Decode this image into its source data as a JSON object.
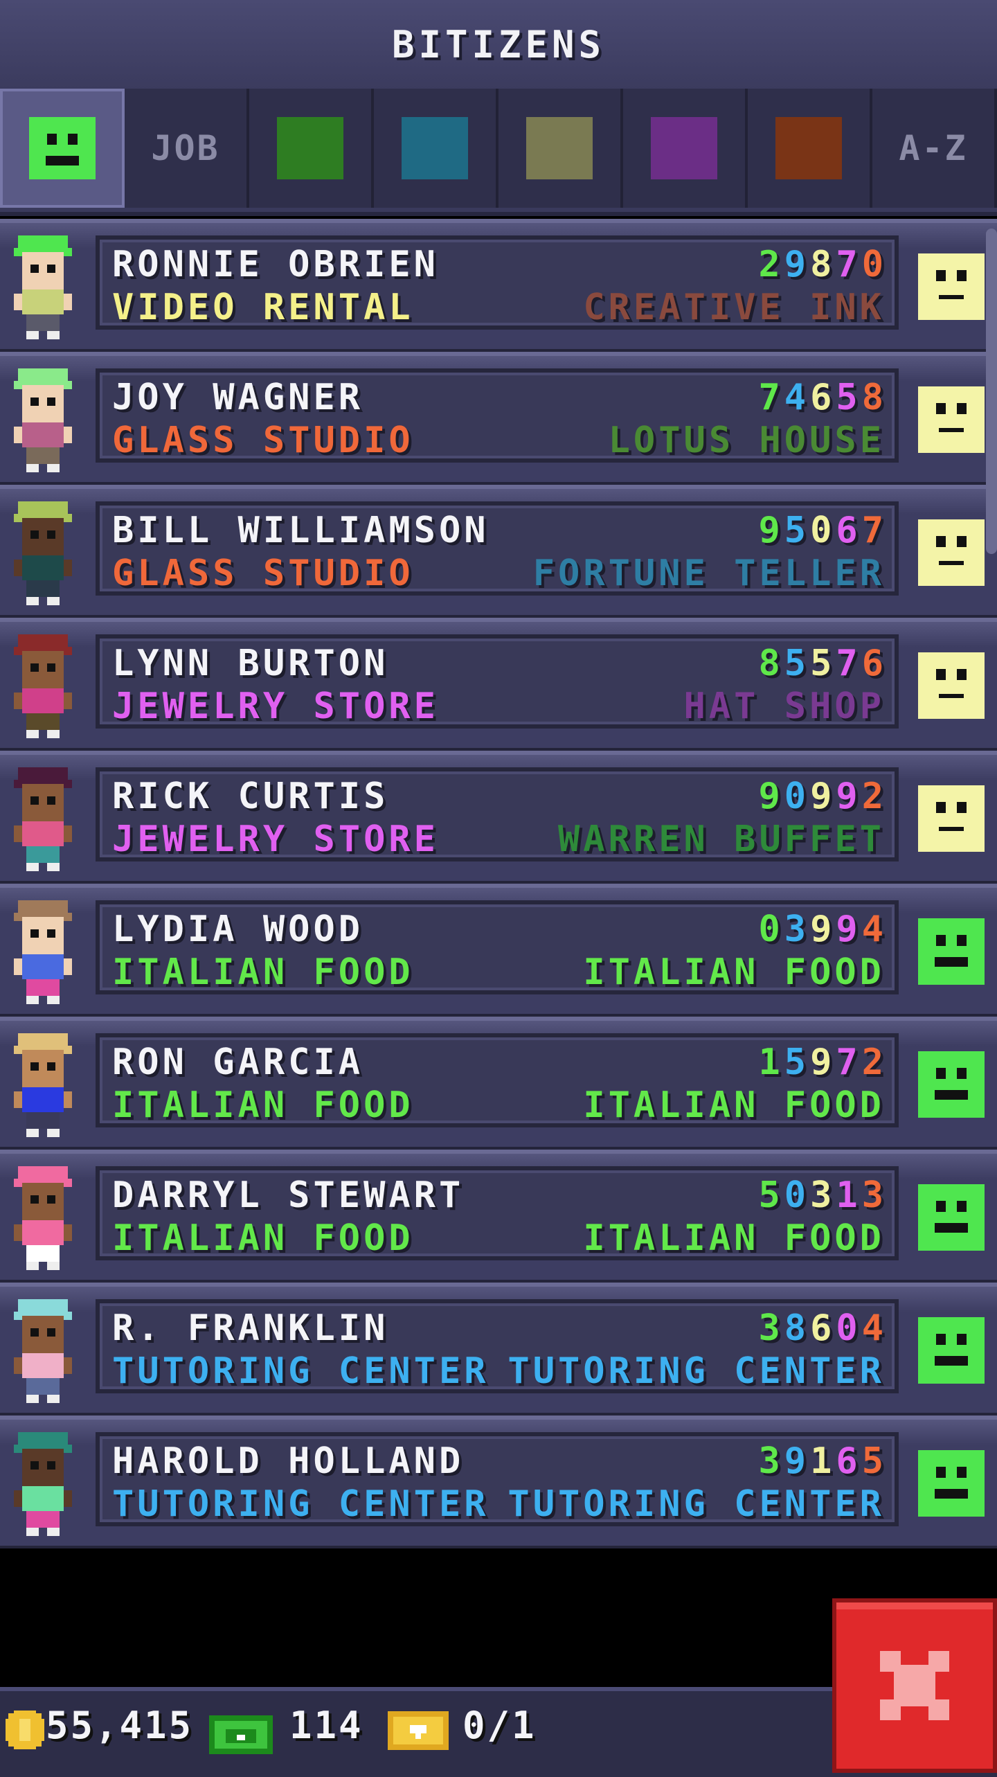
{
  "header": {
    "title": "BITIZENS"
  },
  "tabs": [
    {
      "type": "face",
      "color": "#4fe64f"
    },
    {
      "type": "text",
      "label": "JOB"
    },
    {
      "type": "swatch",
      "color": "#2e7d22"
    },
    {
      "type": "swatch",
      "color": "#1f6a84"
    },
    {
      "type": "swatch",
      "color": "#7a7a52"
    },
    {
      "type": "swatch",
      "color": "#6b2e86"
    },
    {
      "type": "swatch",
      "color": "#7a3416"
    },
    {
      "type": "text",
      "label": "A-Z"
    }
  ],
  "digit_colors": [
    "#5fe84a",
    "#3db0f0",
    "#f0f0a0",
    "#e060f0",
    "#f06a3a"
  ],
  "bitizens": [
    {
      "name": "RONNIE OBRIEN",
      "digits": "29870",
      "job": "VIDEO RENTAL",
      "job_color": "#f4f08a",
      "dream": "CREATIVE INK",
      "dream_color": "#8a4a3e",
      "mood": "neutral",
      "hair": "#4fe64f",
      "skin": "#f0d2b4",
      "shirt": "#c8d27a",
      "pants": "#5a5a6a"
    },
    {
      "name": "JOY WAGNER",
      "digits": "74658",
      "job": "GLASS STUDIO",
      "job_color": "#f0683a",
      "dream": "LOTUS HOUSE",
      "dream_color": "#4a8a34",
      "mood": "neutral",
      "hair": "#8aea8a",
      "skin": "#f0d2b4",
      "shirt": "#b8608a",
      "pants": "#7a6a5a"
    },
    {
      "name": "BILL WILLIAMSON",
      "digits": "95067",
      "job": "GLASS STUDIO",
      "job_color": "#f0683a",
      "dream": "FORTUNE TELLER",
      "dream_color": "#2e7ea4",
      "mood": "neutral",
      "hair": "#a8c45a",
      "skin": "#5a3a28",
      "shirt": "#1e4a4a",
      "pants": "#2a3a4a"
    },
    {
      "name": "LYNN BURTON",
      "digits": "85576",
      "job": "JEWELRY STORE",
      "job_color": "#e060f0",
      "dream": "HAT SHOP",
      "dream_color": "#7a3a92",
      "mood": "neutral",
      "hair": "#8a2a2a",
      "skin": "#8a5a3a",
      "shirt": "#d0408a",
      "pants": "#5a4a2a"
    },
    {
      "name": "RICK CURTIS",
      "digits": "90992",
      "job": "JEWELRY STORE",
      "job_color": "#e060f0",
      "dream": "WARREN BUFFET",
      "dream_color": "#2e8a3a",
      "mood": "neutral",
      "hair": "#4a1a3a",
      "skin": "#8a5a3a",
      "shirt": "#e05a8a",
      "pants": "#3a9a9a"
    },
    {
      "name": "LYDIA WOOD",
      "digits": "03994",
      "job": "ITALIAN FOOD",
      "job_color": "#62e84a",
      "dream": "ITALIAN FOOD",
      "dream_color": "#62e84a",
      "mood": "happy",
      "hair": "#a07a5a",
      "skin": "#f0d2b4",
      "shirt": "#4a6ae0",
      "pants": "#e04aa0"
    },
    {
      "name": "RON GARCIA",
      "digits": "15972",
      "job": "ITALIAN FOOD",
      "job_color": "#62e84a",
      "dream": "ITALIAN FOOD",
      "dream_color": "#62e84a",
      "mood": "happy",
      "hair": "#e0c07a",
      "skin": "#c08a5a",
      "shirt": "#2a3ae0",
      "pants": "#3a3a5a"
    },
    {
      "name": "DARRYL STEWART",
      "digits": "50313",
      "job": "ITALIAN FOOD",
      "job_color": "#62e84a",
      "dream": "ITALIAN FOOD",
      "dream_color": "#62e84a",
      "mood": "happy",
      "hair": "#f06aa0",
      "skin": "#8a5a3a",
      "shirt": "#f06aa0",
      "pants": "#ffffff"
    },
    {
      "name": "R. FRANKLIN",
      "digits": "38604",
      "job": "TUTORING CENTER",
      "job_color": "#3db0f0",
      "dream": "TUTORING CENTER",
      "dream_color": "#3db0f0",
      "mood": "happy",
      "hair": "#8adada",
      "skin": "#8a5a3a",
      "shirt": "#f0b0c8",
      "pants": "#5a6a9a"
    },
    {
      "name": "HAROLD HOLLAND",
      "digits": "39165",
      "job": "TUTORING CENTER",
      "job_color": "#3db0f0",
      "dream": "TUTORING CENTER",
      "dream_color": "#3db0f0",
      "mood": "happy",
      "hair": "#2a8a7a",
      "skin": "#5a3a28",
      "shirt": "#6ae0a0",
      "pants": "#e04aa0"
    }
  ],
  "mood_colors": {
    "neutral": "#f4f4a8",
    "happy": "#4fe64f"
  },
  "footer": {
    "coins": "55,415",
    "bux": "114",
    "tickets": "0/1"
  }
}
